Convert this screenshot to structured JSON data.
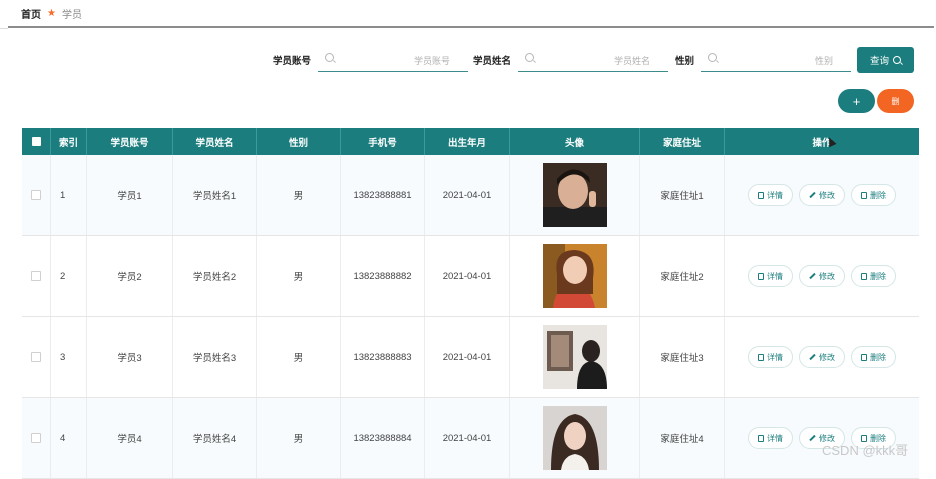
{
  "breadcrumb": {
    "home": "首页",
    "current": "学员"
  },
  "search": {
    "account_label": "学员账号",
    "account_placeholder": "学员账号",
    "name_label": "学员姓名",
    "name_placeholder": "学员姓名",
    "gender_label": "性别",
    "gender_placeholder": "性别",
    "query_label": "查询"
  },
  "actions": {
    "add_label": "+",
    "delete_label": "删"
  },
  "table": {
    "headers": [
      "",
      "索引",
      "学员账号",
      "学员姓名",
      "性别",
      "手机号",
      "出生年月",
      "头像",
      "家庭住址",
      "操作"
    ],
    "rows": [
      {
        "index": "1",
        "account": "学员1",
        "name": "学员姓名1",
        "gender": "男",
        "phone": "13823888881",
        "birth": "2021-04-01",
        "address": "家庭住址1"
      },
      {
        "index": "2",
        "account": "学员2",
        "name": "学员姓名2",
        "gender": "男",
        "phone": "13823888882",
        "birth": "2021-04-01",
        "address": "家庭住址2"
      },
      {
        "index": "3",
        "account": "学员3",
        "name": "学员姓名3",
        "gender": "男",
        "phone": "13823888883",
        "birth": "2021-04-01",
        "address": "家庭住址3"
      },
      {
        "index": "4",
        "account": "学员4",
        "name": "学员姓名4",
        "gender": "男",
        "phone": "13823888884",
        "birth": "2021-04-01",
        "address": "家庭住址4"
      }
    ],
    "ops": {
      "detail": "详情",
      "edit": "修改",
      "delete": "删除"
    }
  },
  "colors": {
    "primary": "#1b7d7d",
    "danger": "#f26522",
    "star": "#f56c2d"
  },
  "watermark": "CSDN @kkk哥"
}
